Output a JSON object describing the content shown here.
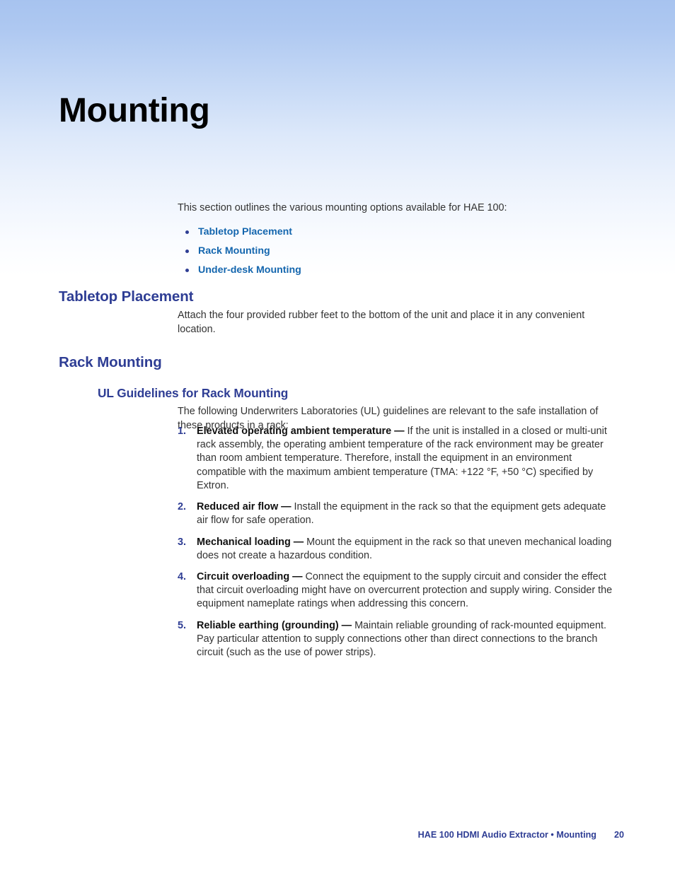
{
  "document": {
    "title": "Mounting"
  },
  "intro": {
    "paragraph": "This section outlines the various mounting options available for HAE 100:",
    "links": [
      {
        "label": "Tabletop Placement"
      },
      {
        "label": "Rack Mounting"
      },
      {
        "label": "Under-desk Mounting"
      }
    ]
  },
  "sections": {
    "tabletop": {
      "heading": "Tabletop Placement",
      "paragraph": "Attach the four provided rubber feet to the bottom of the unit and place it in any convenient location."
    },
    "rack": {
      "heading": "Rack Mounting",
      "subheading": "UL Guidelines for Rack Mounting",
      "paragraph": "The following Underwriters Laboratories (UL) guidelines are relevant to the safe installation of these products in a rack:",
      "items": [
        {
          "number": "1.",
          "lead": "Elevated operating ambient temperature",
          "dash": "—",
          "text": "If the unit is installed in a closed or multi-unit rack assembly, the operating ambient temperature of the rack environment may be greater than room ambient temperature. Therefore, install the equipment in an environment compatible with the maximum ambient temperature (TMA: +122 °F, +50 °C) specified by Extron."
        },
        {
          "number": "2.",
          "lead": "Reduced air flow",
          "dash": "—",
          "text": "Install the equipment in the rack so that the equipment gets adequate air flow for safe operation."
        },
        {
          "number": "3.",
          "lead": "Mechanical loading",
          "dash": "—",
          "text": "Mount the equipment in the rack so that uneven mechanical loading does not create a hazardous condition."
        },
        {
          "number": "4.",
          "lead": "Circuit overloading",
          "dash": "—",
          "text": "Connect the equipment to the supply circuit and consider the effect that circuit overloading might have on overcurrent protection and supply wiring. Consider the equipment nameplate ratings when addressing this concern."
        },
        {
          "number": "5.",
          "lead": "Reliable earthing (grounding)",
          "dash": "—",
          "text": "Maintain reliable grounding of rack-mounted equipment. Pay particular attention to supply connections other than direct connections to the branch circuit (such as the use of power strips)."
        }
      ]
    }
  },
  "footer": {
    "text": "HAE 100 HDMI Audio Extractor • Mounting",
    "page_number": "20"
  },
  "colors": {
    "heading_indigo": "#2e3d94",
    "link_blue": "#1466ae",
    "body_gray": "#333333",
    "gradient_top": "#a7c3ef",
    "gradient_bottom": "#ffffff"
  }
}
